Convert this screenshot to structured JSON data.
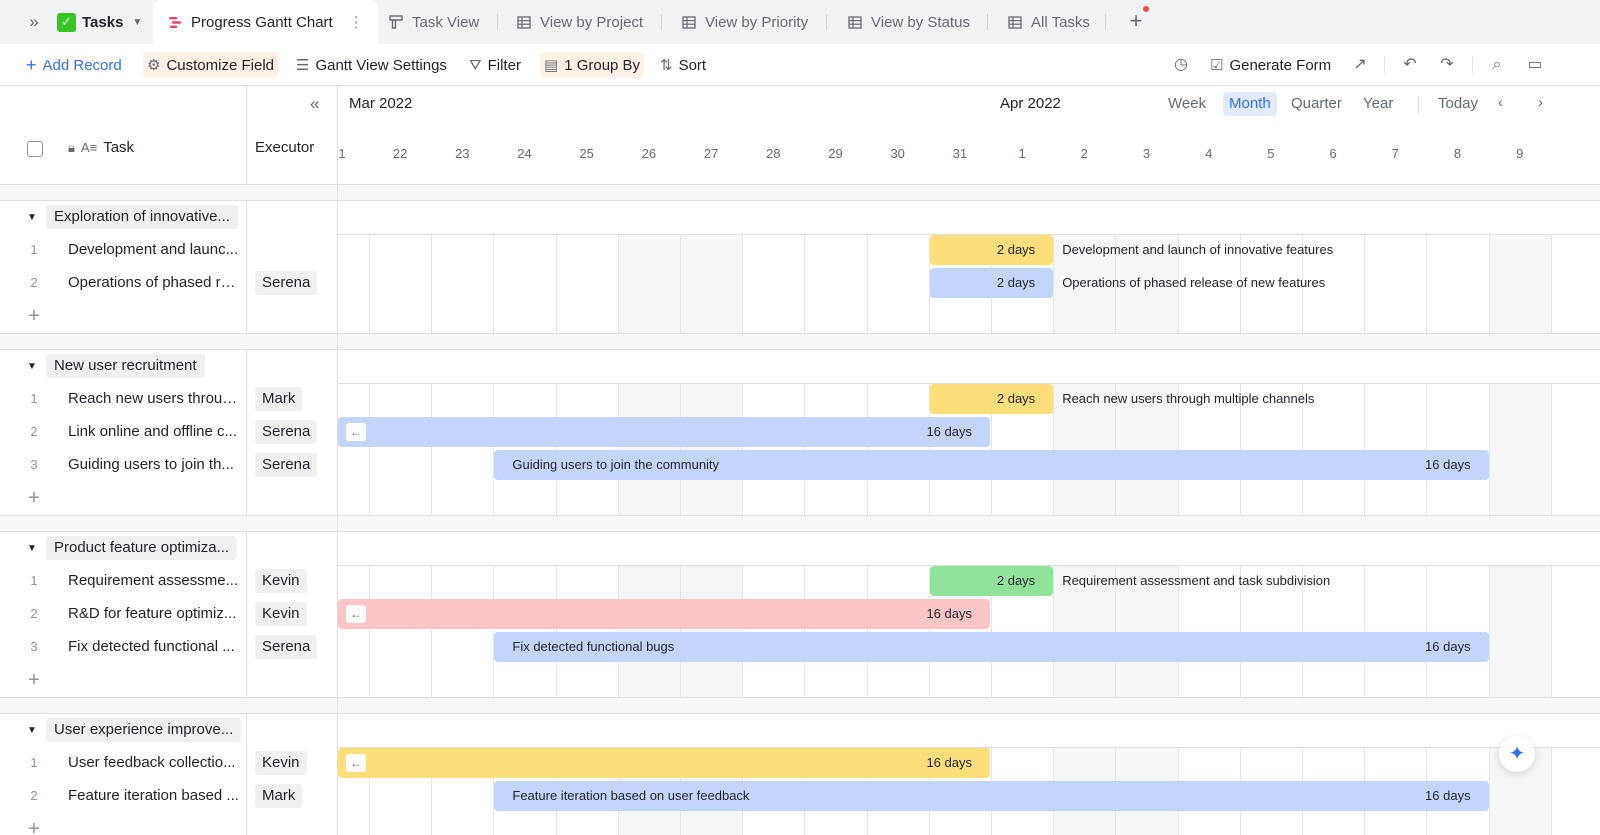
{
  "app": {
    "name": "Tasks"
  },
  "tabs": [
    {
      "label": "Progress Gantt Chart",
      "icon": "gantt-icon",
      "active": true
    },
    {
      "label": "Task View",
      "icon": "kanban-icon"
    },
    {
      "label": "View by Project",
      "icon": "grid-icon"
    },
    {
      "label": "View by Priority",
      "icon": "grid-icon"
    },
    {
      "label": "View by Status",
      "icon": "grid-icon"
    },
    {
      "label": "All Tasks",
      "icon": "grid-icon"
    }
  ],
  "toolbar": {
    "add_record": "Add Record",
    "customize_field": "Customize Field",
    "gantt_settings": "Gantt View Settings",
    "filter": "Filter",
    "group_by": "1 Group By",
    "sort": "Sort",
    "generate_form": "Generate Form"
  },
  "grid_header": {
    "task": "Task",
    "executor": "Executor"
  },
  "timeline": {
    "months": [
      "Mar 2022",
      "Apr 2022"
    ],
    "scales": [
      "Week",
      "Month",
      "Quarter",
      "Year"
    ],
    "active_scale": "Month",
    "today": "Today",
    "days": [
      "1",
      "22",
      "23",
      "24",
      "25",
      "26",
      "27",
      "28",
      "29",
      "30",
      "31",
      "1",
      "2",
      "3",
      "4",
      "5",
      "6",
      "7",
      "8",
      "9"
    ]
  },
  "groups": [
    {
      "label": "Exploration of innovative...",
      "rows": [
        {
          "num": "1",
          "task": "Development and launc...",
          "executor": "",
          "bar_label": "Development and launch of innovative features",
          "duration": "2 days",
          "start": 10,
          "span": 2,
          "color": "#fcde7a"
        },
        {
          "num": "2",
          "task": "Operations of phased re...",
          "executor": "Serena",
          "bar_label": "Operations of phased release of new features",
          "duration": "2 days",
          "start": 10,
          "span": 2,
          "color": "#c4d5fd"
        }
      ]
    },
    {
      "label": "New user recruitment",
      "rows": [
        {
          "num": "1",
          "task": "Reach new users throug...",
          "executor": "Mark",
          "bar_label": "Reach new users through multiple channels",
          "duration": "2 days",
          "start": 10,
          "span": 2,
          "color": "#fcde7a"
        },
        {
          "num": "2",
          "task": "Link online and offline c...",
          "executor": "Serena",
          "bar_label": "",
          "duration": "16 days",
          "start": 0,
          "span": 11,
          "color": "#c4d5fd",
          "continues_left": true
        },
        {
          "num": "3",
          "task": "Guiding users to join th...",
          "executor": "Serena",
          "bar_label": "Guiding users to join the community",
          "duration": "16 days",
          "start": 3,
          "span": 16,
          "color": "#c4d5fd",
          "label_inside": true
        }
      ]
    },
    {
      "label": "Product feature optimiza...",
      "rows": [
        {
          "num": "1",
          "task": "Requirement assessme...",
          "executor": "Kevin",
          "bar_label": "Requirement assessment and task subdivision",
          "duration": "2 days",
          "start": 10,
          "span": 2,
          "color": "#91e39c"
        },
        {
          "num": "2",
          "task": "R&D for feature optimiz...",
          "executor": "Kevin",
          "bar_label": "",
          "duration": "16 days",
          "start": 0,
          "span": 11,
          "color": "#fbc6c5",
          "continues_left": true
        },
        {
          "num": "3",
          "task": "Fix detected functional ...",
          "executor": "Serena",
          "bar_label": "Fix detected functional bugs",
          "duration": "16 days",
          "start": 3,
          "span": 16,
          "color": "#c4d5fd",
          "label_inside": true
        }
      ]
    },
    {
      "label": "User experience improve...",
      "rows": [
        {
          "num": "1",
          "task": "User feedback collectio...",
          "executor": "Kevin",
          "bar_label": "",
          "duration": "16 days",
          "start": 0,
          "span": 11,
          "color": "#fcde7a",
          "continues_left": true
        },
        {
          "num": "2",
          "task": "Feature iteration based ...",
          "executor": "Mark",
          "bar_label": "Feature iteration based on user feedback",
          "duration": "16 days",
          "start": 3,
          "span": 16,
          "color": "#c4d5fd",
          "label_inside": true
        }
      ]
    }
  ]
}
